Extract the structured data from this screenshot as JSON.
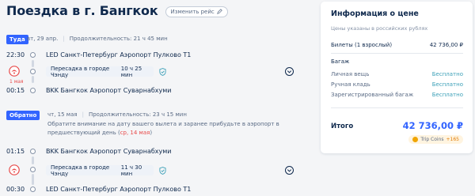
{
  "header": {
    "title": "Поездка в г. Бангкок",
    "change_trip": "Изменить рейс"
  },
  "outbound": {
    "tag": "Туда",
    "date": "вт, 29 апр.",
    "duration": "Продолжительность: 21 ч 45 мин",
    "dep_time": "22:30",
    "dep_airport": "LED Санкт-Петербург Аэропорт Пулково Т1",
    "transfer_city": "Пересадка в городе Чэнду",
    "transfer_duration": "10 ч 25 мин",
    "arr_date_note": "1 мая",
    "arr_time": "00:15",
    "arr_airport": "BKK Бангкок Аэропорт Суварнабхуми"
  },
  "return": {
    "tag": "Обратно",
    "date": "чт, 15 мая",
    "duration": "Продолжительность: 23 ч 15 мин",
    "notice_text": "Обратите внимание на дату вашего вылета и заранее прибудьте в аэропорт в предшествующий день (",
    "notice_date": "ср, 14 мая",
    "notice_end": ")",
    "dep_time": "01:15",
    "dep_airport": "BKK Бангкок Аэропорт Суварнабхуми",
    "transfer_city": "Пересадка в городе Чэнду",
    "transfer_duration": "11 ч 30 мин",
    "arr_time": "00:30",
    "arr_airport": "LED Санкт-Петербург Аэропорт Пулково Т1"
  },
  "price_card": {
    "title": "Информация о цене",
    "subtitle": "Цены указаны в российских рублях",
    "tickets_label": "Билеты (1 взрослый)",
    "tickets_value": "42 736,00 ₽",
    "baggage_heading": "Багаж",
    "baggage": [
      {
        "label": "Личная вещь",
        "value": "Бесплатно"
      },
      {
        "label": "Ручная кладь",
        "value": "Бесплатно"
      },
      {
        "label": "Зарегистрированный багаж",
        "value": "Бесплатно"
      }
    ],
    "total_label": "Итого",
    "total_value": "42 736,00 ₽",
    "coins_label": "Trip Coins",
    "coins_value": "+165"
  },
  "colors": {
    "accent": "#3264ff",
    "free": "#3ca0b8",
    "warning": "#e84b4b"
  }
}
